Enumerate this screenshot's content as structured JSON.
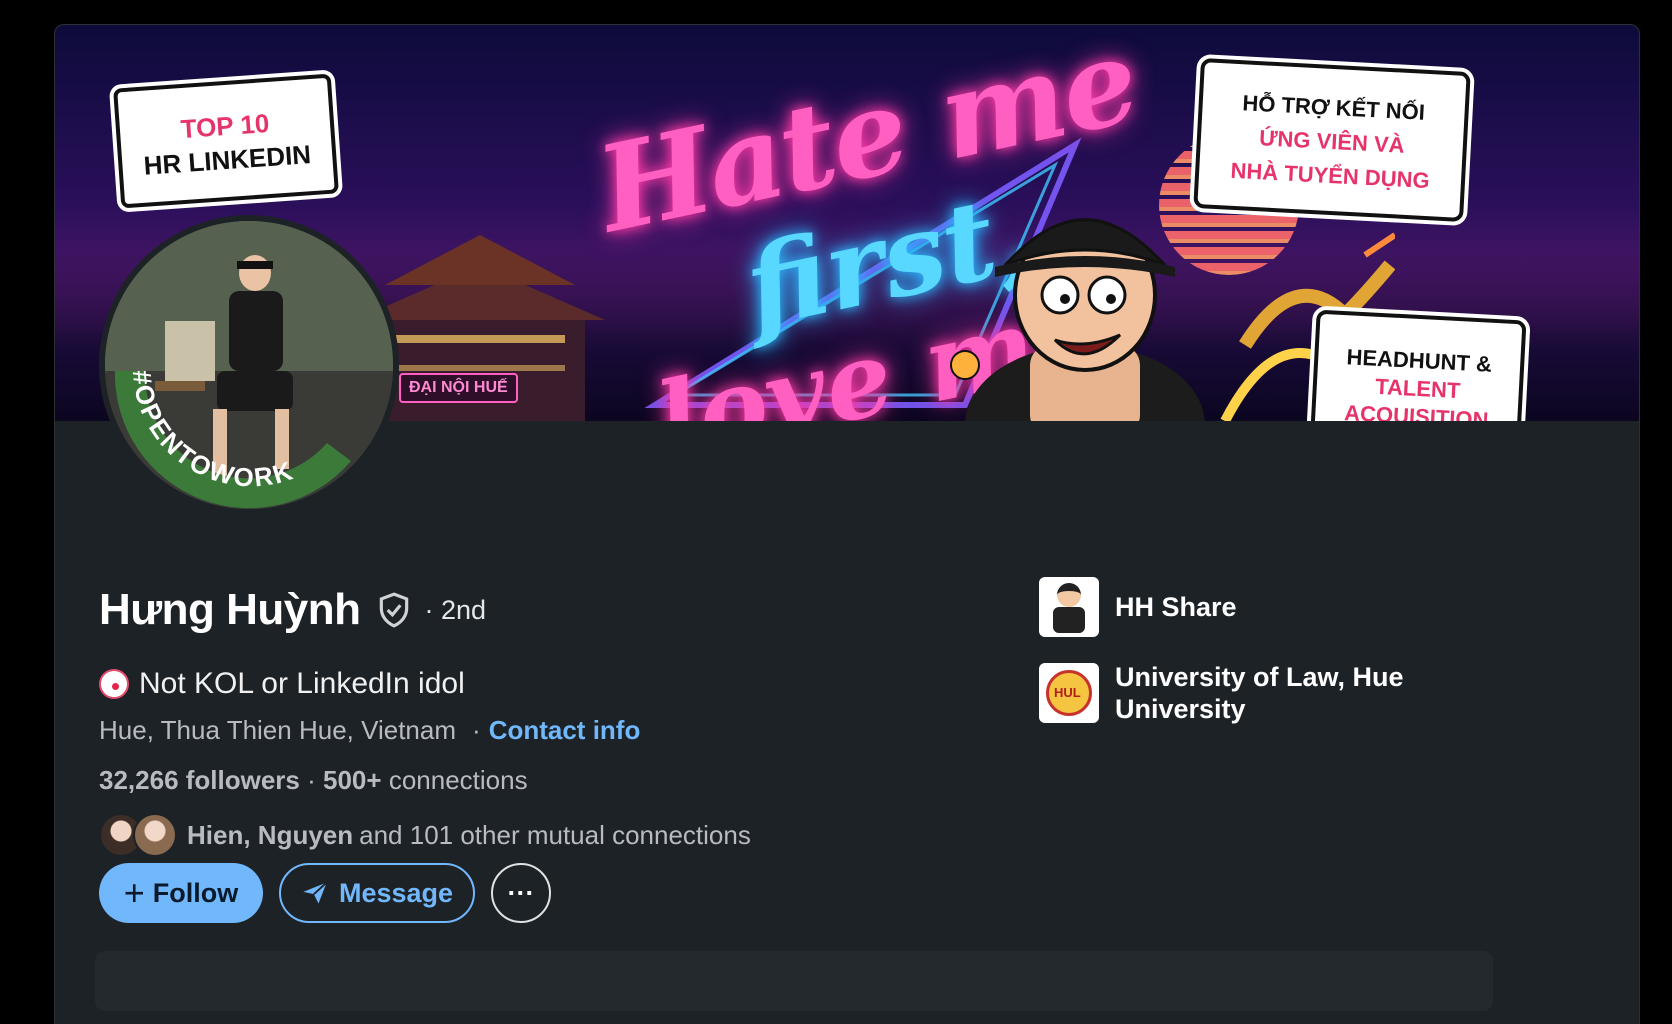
{
  "banner": {
    "bubble_left_line1": "TOP 10",
    "bubble_left_line2": "HR LINKEDIN",
    "bubble_right_line1": "HỖ TRỢ KẾT NỐI",
    "bubble_right_line2": "ỨNG VIÊN VÀ",
    "bubble_right_line3": "NHÀ TUYỂN DỤNG",
    "bubble_hh_line1": "HEADHUNT &",
    "bubble_hh_line2": "TALENT",
    "bubble_hh_line3": "ACQUISITION",
    "neon_line1": "Hate me",
    "neon_line2": "first,",
    "neon_line3": "love me",
    "palace_sign": "ĐẠI NỘI HUẾ"
  },
  "avatar": {
    "badge_text": "#OPENTOWORK"
  },
  "profile": {
    "name": "Hưng Huỳnh",
    "degree": "· 2nd",
    "headline": "Not KOL or LinkedIn idol",
    "location": "Hue, Thua Thien Hue, Vietnam",
    "contact_info": "Contact info",
    "followers_count": "32,266 followers",
    "connections_count": "500+",
    "connections_label": "connections",
    "mutual_names": "Hien, Nguyen",
    "mutual_rest": "and 101 other mutual connections"
  },
  "actions": {
    "follow_label": "Follow",
    "message_label": "Message",
    "more_label": "···"
  },
  "right": {
    "company": "HH Share",
    "school": "University of Law, Hue University"
  },
  "colors": {
    "accent": "#71b7fb",
    "card_bg": "#1d2226",
    "opentowork_green": "#3c7a3a"
  },
  "icons": [
    "verified-shield-icon",
    "clown-emoji-icon",
    "plus-icon",
    "send-icon",
    "more-icon"
  ]
}
